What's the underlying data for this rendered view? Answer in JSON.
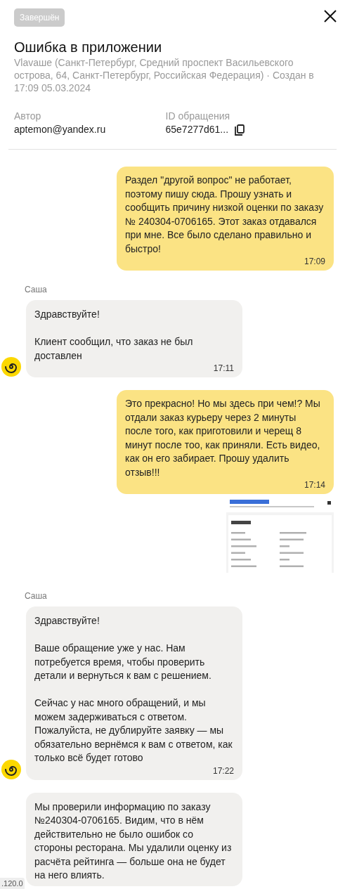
{
  "status": {
    "label": "Завершён"
  },
  "title": "Ошибка в приложении",
  "subtitle": {
    "place": "Vlavaше (Санкт-Петербург, Средний проспект Васильевского острова, 64, Санкт-Петербург, Российская Федерация)",
    "separator": "·",
    "created": "Создан в 17:09 05.03.2024"
  },
  "fields": [
    {
      "label": "Автор",
      "value": "aptemon@yandex.ru",
      "copyable": false
    },
    {
      "label": "ID обращения",
      "value": "65e7277d61...",
      "copyable": true
    }
  ],
  "messages": [
    {
      "kind": "outgoing",
      "paragraphs": [
        "Раздел \"другой вопрос\" не работает, поэтому пишу сюда. Прошу узнать и сообщить причину низкой оценки по заказу № 240304-0706165. Этот заказ отдавался при мне. Все было сделано правильно и быстро!"
      ],
      "time": "17:09"
    },
    {
      "kind": "incoming",
      "sender": "Саша",
      "avatar": true,
      "paragraphs": [
        "Здравствуйте!",
        "Клиент сообщил, что заказ не был доставлен"
      ],
      "time": "17:11"
    },
    {
      "kind": "outgoing",
      "paragraphs": [
        "Это прекрасно! Но мы здесь при чем!? Мы отдали заказ курьеру через 2 минуты после того, как приготовили и черещ 8 минут после тоо, как приняли. Есть видео, как он его забирает. Прошу удалить отзыв!!!"
      ],
      "time": "17:14"
    },
    {
      "kind": "attachment"
    },
    {
      "kind": "incoming",
      "sender": "Саша",
      "avatar": true,
      "paragraphs": [
        "Здравствуйте!",
        "Ваше обращение уже у нас. Нам потребуется время, чтобы проверить детали и вернуться к вам с решением.",
        "Сейчас у нас много обращений, и мы можем задерживаться с ответом. Пожалуйста, не дублируйте заявку — мы обязательно вернёмся к вам с ответом, как только всё будет готово"
      ],
      "time": "17:22"
    },
    {
      "kind": "incoming",
      "avatar": false,
      "paragraphs": [
        "Мы проверили информацию по заказу №240304-0706165. Видим, что в нём действительно не было ошибок со стороны ресторана. Мы удалили оценку из расчёта рейтинга — больше она не будет на него влиять."
      ]
    }
  ],
  "version": ".120.0"
}
